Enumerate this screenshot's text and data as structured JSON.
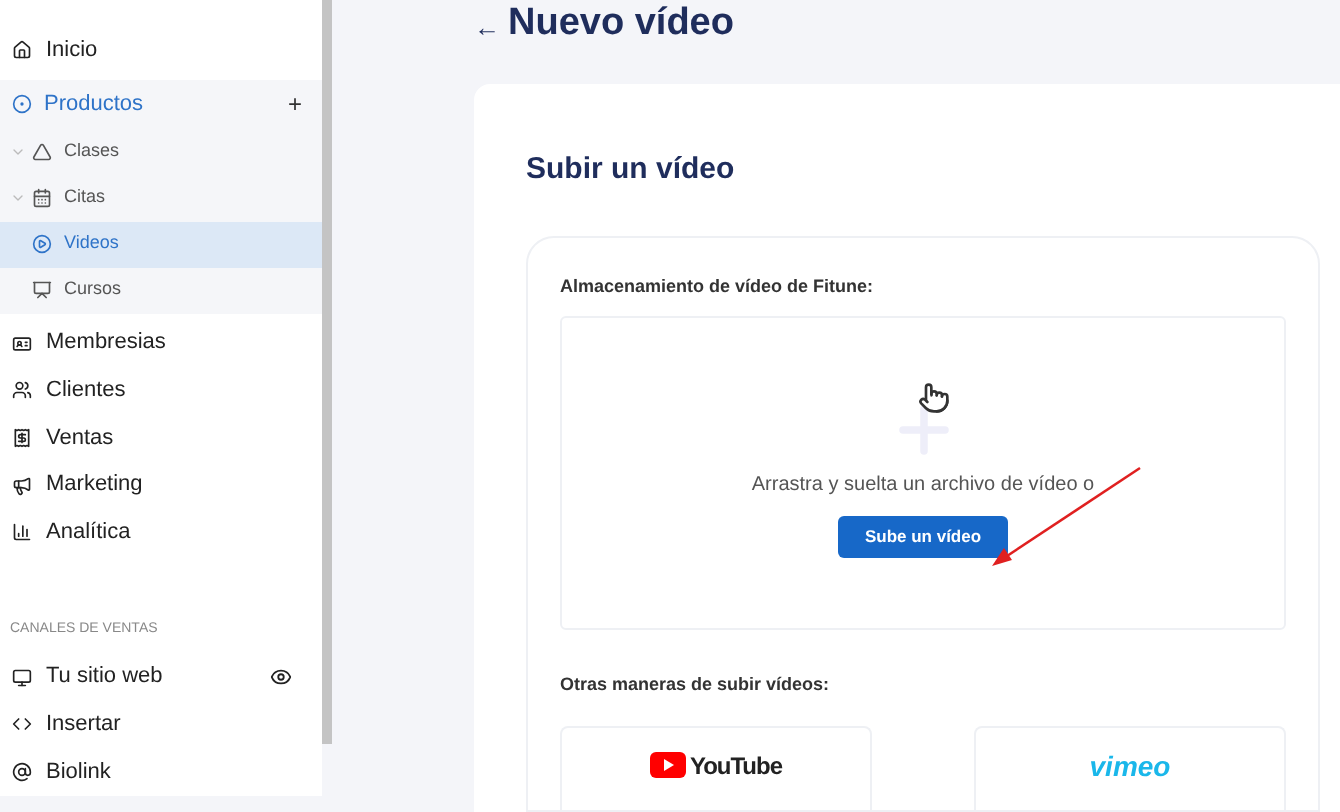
{
  "sidebar": {
    "items": [
      {
        "kind": "item",
        "label": "Inicio",
        "selected": false
      },
      {
        "kind": "group",
        "label": "Productos",
        "selected": true,
        "action": "+",
        "children": [
          {
            "kind": "collapsible",
            "label": "Clases",
            "selected": false
          },
          {
            "kind": "collapsible",
            "label": "Citas",
            "selected": false
          },
          {
            "kind": "plain",
            "label": "Videos",
            "selected": true
          },
          {
            "kind": "plain",
            "label": "Cursos",
            "selected": false
          }
        ]
      },
      {
        "kind": "item",
        "label": "Membresias",
        "selected": false
      },
      {
        "kind": "item",
        "label": "Clientes",
        "selected": false
      },
      {
        "kind": "item",
        "label": "Ventas",
        "selected": false
      },
      {
        "kind": "item",
        "label": "Marketing",
        "selected": false
      },
      {
        "kind": "item",
        "label": "Analítica",
        "selected": false
      },
      {
        "kind": "heading",
        "label": "CANALES DE VENTAS"
      },
      {
        "kind": "channel",
        "label": "Tu sitio web",
        "selected": false
      },
      {
        "kind": "item",
        "label": "Insertar",
        "selected": false
      },
      {
        "kind": "item",
        "label": "Biolink",
        "selected": false
      }
    ]
  },
  "page": {
    "back": "←",
    "title": "Nuevo vídeo",
    "card_title": "Subir un vídeo",
    "storage": {
      "label": "Almacenamiento de vídeo de Fitune:",
      "drop_text": "Arrastra y suelta un archivo de vídeo o",
      "button": "Sube un vídeo"
    },
    "others": {
      "label": "Otras maneras de subir vídeos:",
      "services": [
        {
          "kind": "youtube",
          "name": "YouTube"
        },
        {
          "kind": "vimeo",
          "name": "vimeo"
        }
      ]
    }
  }
}
